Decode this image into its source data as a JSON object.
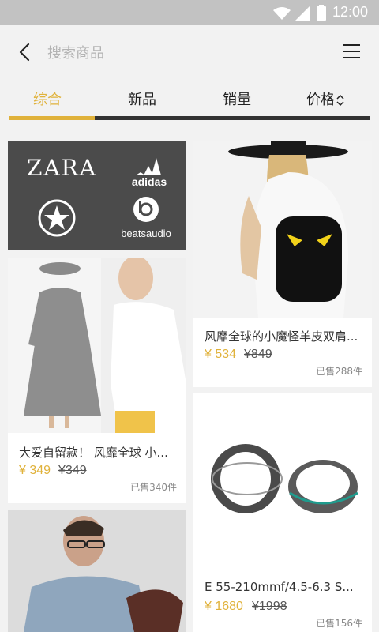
{
  "status": {
    "time": "12:00"
  },
  "header": {
    "search_placeholder": "搜索商品"
  },
  "tabs": [
    {
      "label": "综合",
      "active": true
    },
    {
      "label": "新品",
      "active": false
    },
    {
      "label": "销量",
      "active": false
    },
    {
      "label": "价格⌄⌃",
      "active": false
    }
  ],
  "brands": [
    "ZARA",
    "adidas",
    "Converse",
    "beatsaudio"
  ],
  "products": [
    {
      "title": "风靡全球的小魔怪羊皮双肩...",
      "price": "¥ 534",
      "old_price": "¥849",
      "sold": "已售288件"
    },
    {
      "title": "大爱自留款！ 风靡全球 小...",
      "price": "¥ 349",
      "old_price": "¥349",
      "sold": "已售340件"
    },
    {
      "title": "E 55-210mmf/4.5-6.3 S...",
      "price": "¥ 1680",
      "old_price": "¥1998",
      "sold": "已售156件"
    }
  ],
  "colors": {
    "accent": "#e0b23b",
    "dark": "#333333",
    "brand_bg": "#4b4b4b"
  }
}
